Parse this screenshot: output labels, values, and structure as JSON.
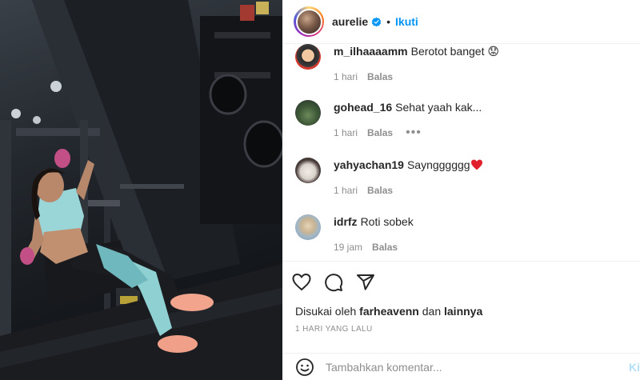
{
  "post": {
    "author": "aurelie",
    "separator": "•",
    "follow_label": "Ikuti"
  },
  "comments": [
    {
      "user": "m_ilhaaaamm",
      "text": "Berotot banget 😟",
      "time": "1 hari",
      "reply": "Balas"
    },
    {
      "user": "gohead_16",
      "text": "Sehat yaah kak...",
      "time": "1 hari",
      "reply": "Balas",
      "more": "•••"
    },
    {
      "user": "yahyachan19",
      "text": "Sayngggggg",
      "time": "1 hari",
      "reply": "Balas"
    },
    {
      "user": "idrfz",
      "text": "Roti sobek",
      "time": "19 jam",
      "reply": "Balas"
    }
  ],
  "actions": {
    "icons": [
      "heart-icon",
      "comment-icon",
      "share-icon"
    ]
  },
  "likes": {
    "prefix": "Disukai oleh",
    "user": "farheavenn",
    "joiner": "dan",
    "others": "lainnya"
  },
  "date": "1 HARI YANG LALU",
  "add_comment": {
    "placeholder": "Tambahkan komentar...",
    "post_label": "Ki"
  },
  "colors": {
    "accent": "#0095f6",
    "text": "#262626",
    "muted": "#8e8e8e",
    "heart": "#ed4956"
  }
}
